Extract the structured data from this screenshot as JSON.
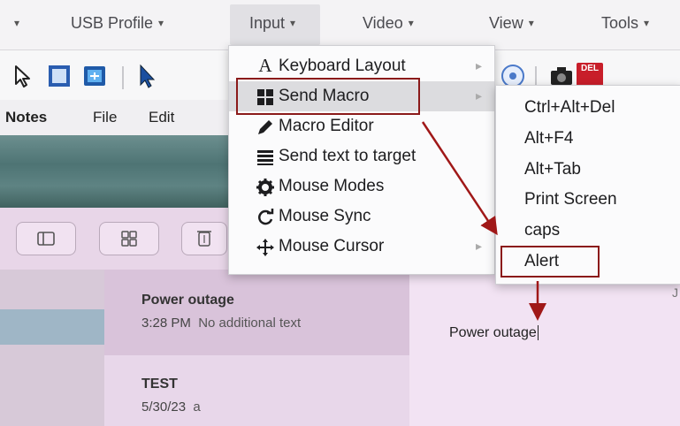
{
  "menubar": {
    "items": [
      {
        "label": "",
        "caret": "▾"
      },
      {
        "label": "USB Profile",
        "caret": "▾"
      },
      {
        "label": "Input",
        "caret": "▾"
      },
      {
        "label": "Video",
        "caret": "▾"
      },
      {
        "label": "View",
        "caret": "▾"
      },
      {
        "label": "Tools",
        "caret": "▾"
      }
    ]
  },
  "toolbar": {
    "icons": [
      "cursor-icon",
      "fullscreen-icon",
      "fit-screen-icon",
      "pointer-icon",
      "disc-icon",
      "camera-icon",
      "ctrl-alt-del-icon"
    ],
    "del_label": "DEL"
  },
  "notes": {
    "menu": [
      "Notes",
      "File",
      "Edit"
    ],
    "list": [
      {
        "title": "Power outage",
        "time": "3:28 PM",
        "preview": "No additional text"
      },
      {
        "title": "TEST",
        "time": "5/30/23",
        "preview": "a"
      }
    ],
    "editor_text": "Power outage",
    "editor_mark": "J"
  },
  "input_menu": {
    "items": [
      {
        "icon": "A",
        "label": "Keyboard Layout",
        "submenu": true
      },
      {
        "icon": "▦",
        "label": "Send Macro",
        "submenu": true
      },
      {
        "icon": "✎",
        "label": "Macro Editor",
        "submenu": false
      },
      {
        "icon": "≣",
        "label": "Send text to target",
        "submenu": false
      },
      {
        "icon": "✿",
        "label": "Mouse Modes",
        "submenu": false
      },
      {
        "icon": "↻",
        "label": "Mouse Sync",
        "submenu": false
      },
      {
        "icon": "✥",
        "label": "Mouse Cursor",
        "submenu": true
      }
    ],
    "submenu_arrow": "▸"
  },
  "macro_menu": {
    "items": [
      "Ctrl+Alt+Del",
      "Alt+F4",
      "Alt+Tab",
      "Print Screen",
      "caps",
      "Alert"
    ]
  },
  "colors": {
    "highlight_box": "#8b1a1a",
    "arrow": "#a01818"
  }
}
